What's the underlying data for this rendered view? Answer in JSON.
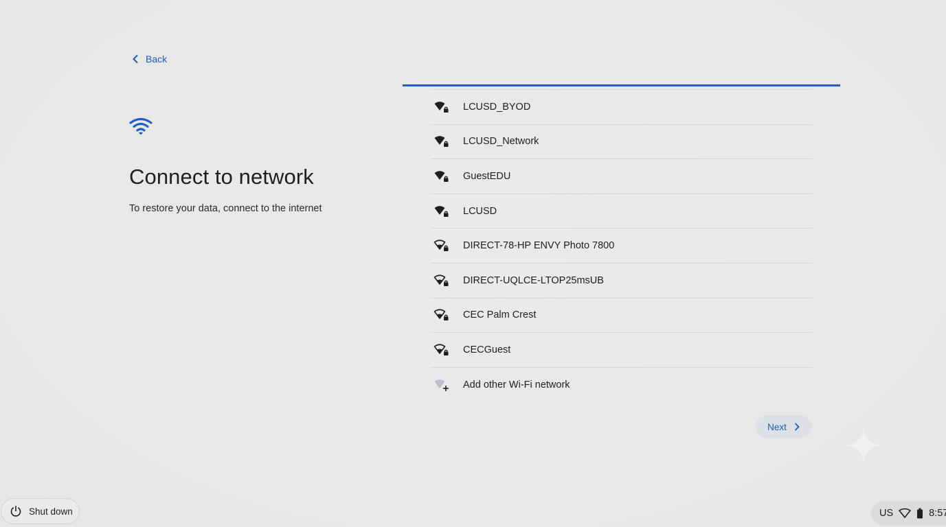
{
  "back": {
    "label": "Back"
  },
  "header": {
    "title": "Connect to network",
    "subtitle": "To restore your data, connect to the internet"
  },
  "progress": {
    "value": 1.0,
    "color": "#1e5fc4"
  },
  "networks": [
    {
      "name": "LCUSD_BYOD",
      "icon": "wifi-locked-full-icon"
    },
    {
      "name": "LCUSD_Network",
      "icon": "wifi-locked-full-icon"
    },
    {
      "name": "GuestEDU",
      "icon": "wifi-locked-full-icon"
    },
    {
      "name": "LCUSD",
      "icon": "wifi-locked-full-icon"
    },
    {
      "name": "DIRECT-78-HP ENVY Photo 7800",
      "icon": "wifi-locked-partial-icon"
    },
    {
      "name": "DIRECT-UQLCE-LTOP25msUB",
      "icon": "wifi-locked-partial-icon"
    },
    {
      "name": "CEC Palm Crest",
      "icon": "wifi-locked-partial-icon"
    },
    {
      "name": "CECGuest",
      "icon": "wifi-locked-partial-icon"
    }
  ],
  "add_network": {
    "label": "Add other Wi-Fi network",
    "icon": "wifi-add-icon"
  },
  "next": {
    "label": "Next"
  },
  "shutdown": {
    "label": "Shut down"
  },
  "tray": {
    "keyboard": "US",
    "time": "8:57"
  },
  "colors": {
    "accent": "#1a5cba",
    "background": "#ebe9e7"
  }
}
